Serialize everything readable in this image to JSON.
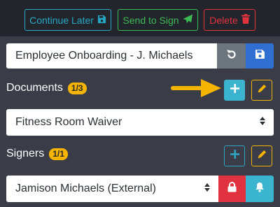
{
  "toolbar": {
    "continue_label": "Continue Later",
    "send_label": "Send to Sign",
    "delete_label": "Delete"
  },
  "title_field": {
    "value": "Employee Onboarding - J. Michaels"
  },
  "documents": {
    "label": "Documents",
    "count_badge": "1/3",
    "selected": "Fitness Room Waiver"
  },
  "signers": {
    "label": "Signers",
    "count_badge": "1/1",
    "selected": "Jamison Michaels (External)"
  },
  "icons": {
    "continue": "save-icon",
    "send": "paper-plane-icon",
    "delete": "trash-icon",
    "undo": "undo-icon",
    "save": "save-icon",
    "add": "plus-icon",
    "edit": "pencil-icon",
    "lock": "lock-icon",
    "bell": "bell-icon",
    "select": "sort-caret-icon",
    "pointer": "arrow-right-icon"
  },
  "colors": {
    "background": "#3a3d47",
    "top_band": "#22252c",
    "info": "#3bb4cf",
    "success": "#3cba54",
    "danger": "#e0323f",
    "primary": "#2f6fd1",
    "secondary": "#6c757d",
    "warning": "#f4b400"
  }
}
